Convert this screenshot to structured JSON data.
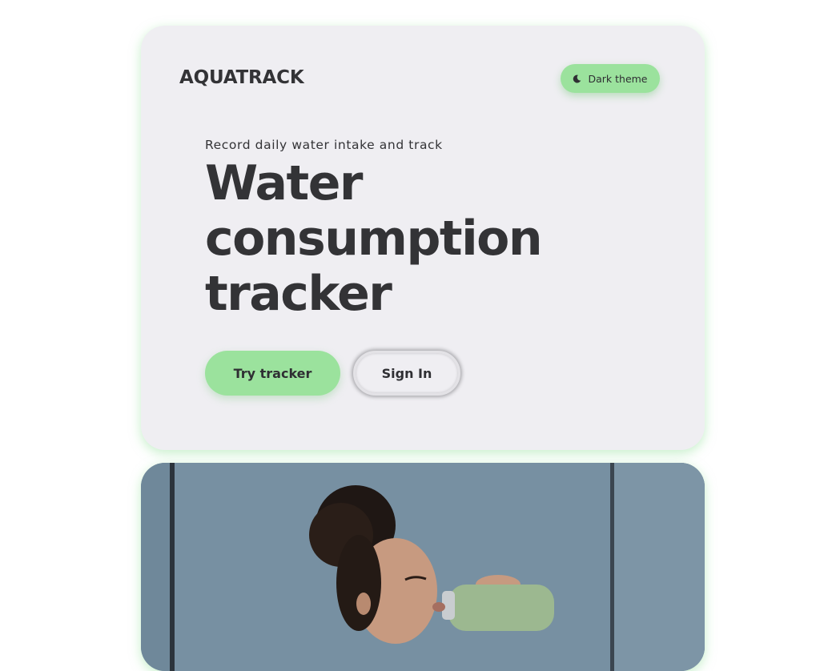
{
  "brand": {
    "logo_text": "AQUATRACK"
  },
  "theme_toggle": {
    "label": "Dark theme",
    "icon": "moon-icon"
  },
  "hero": {
    "subtitle": "Record daily water intake and track",
    "headline_lines": [
      "Water",
      "consumption",
      "tracker"
    ]
  },
  "actions": {
    "try_label": "Try tracker",
    "signin_label": "Sign In"
  },
  "colors": {
    "accent_green": "#9be29d",
    "card_background": "#efeef2",
    "text_dark": "#333336"
  }
}
